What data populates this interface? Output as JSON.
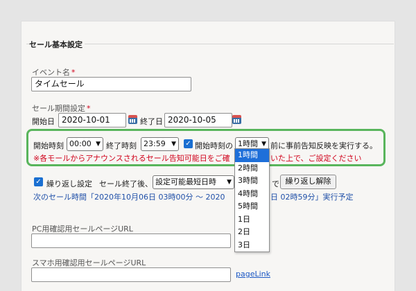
{
  "section_title": "セール基本設定",
  "event": {
    "label": "イベント名",
    "required_mark": "*",
    "value": "タイムセール"
  },
  "period": {
    "label": "セール期間設定",
    "required_mark": "*",
    "start_label": "開始日",
    "start_date": "2020-10-01",
    "end_label": "終了日",
    "end_date": "2020-10-05"
  },
  "time_row": {
    "start_time_label": "開始時刻",
    "start_time": "00:00",
    "end_time_label": "終了時刻",
    "end_time": "23:59",
    "checkbox_label": "開始時刻の",
    "lead_time": "1時間",
    "suffix": "前に事前告知反映を実行する。",
    "note": "※各モールからアナウンスされるセール告知可能日をご確",
    "note_tail": "いた上で、ご設定ください"
  },
  "lead_time_options": [
    "1時間",
    "2時間",
    "3時間",
    "4時間",
    "5時間",
    "1日",
    "2日",
    "3日"
  ],
  "repeat": {
    "label": "繰り返し設定",
    "text": "セール終了後、",
    "select_value": "設定可能最短日時",
    "tail": "で",
    "release_button": "繰り返し解除",
    "next_prefix": "次のセール時間「2020年10月06日 03時00分 ～ 2020",
    "next_suffix": "日 02時59分」実行予定"
  },
  "pc_url": {
    "label": "PC用確認用セールページURL",
    "value": ""
  },
  "sp_url": {
    "label": "スマホ用確認用セールページURL",
    "value": "",
    "link": "pageLink"
  },
  "colors": {
    "highlight": "#59b55c",
    "accent": "#1e6fd9",
    "warning": "#d0021b",
    "link": "#1f4fa8"
  }
}
